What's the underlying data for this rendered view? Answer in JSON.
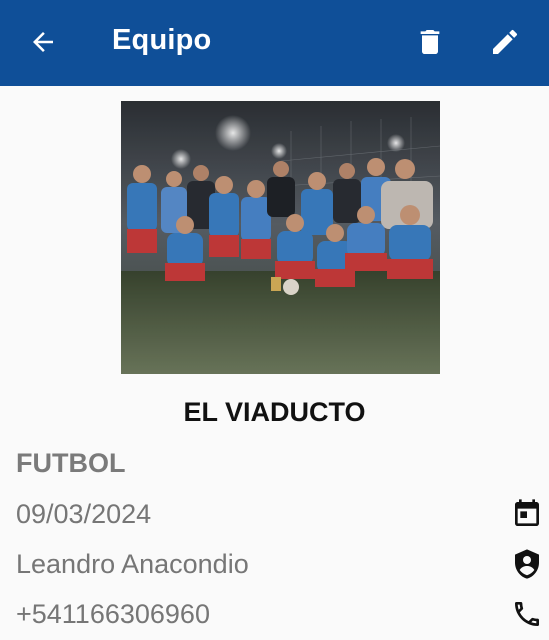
{
  "header": {
    "title": "Equipo",
    "background": "#0f4f98"
  },
  "team": {
    "photo_alt": "",
    "name": "EL VIADUCTO",
    "sport": "FUTBOL",
    "date": "09/03/2024",
    "captain": "Leandro Anacondio",
    "phone": "+541166306960"
  },
  "icons": {
    "back": "arrow-left-icon",
    "delete": "trash-icon",
    "edit": "pencil-icon",
    "date": "calendar-icon",
    "captain": "shield-person-icon",
    "phone": "phone-icon"
  }
}
